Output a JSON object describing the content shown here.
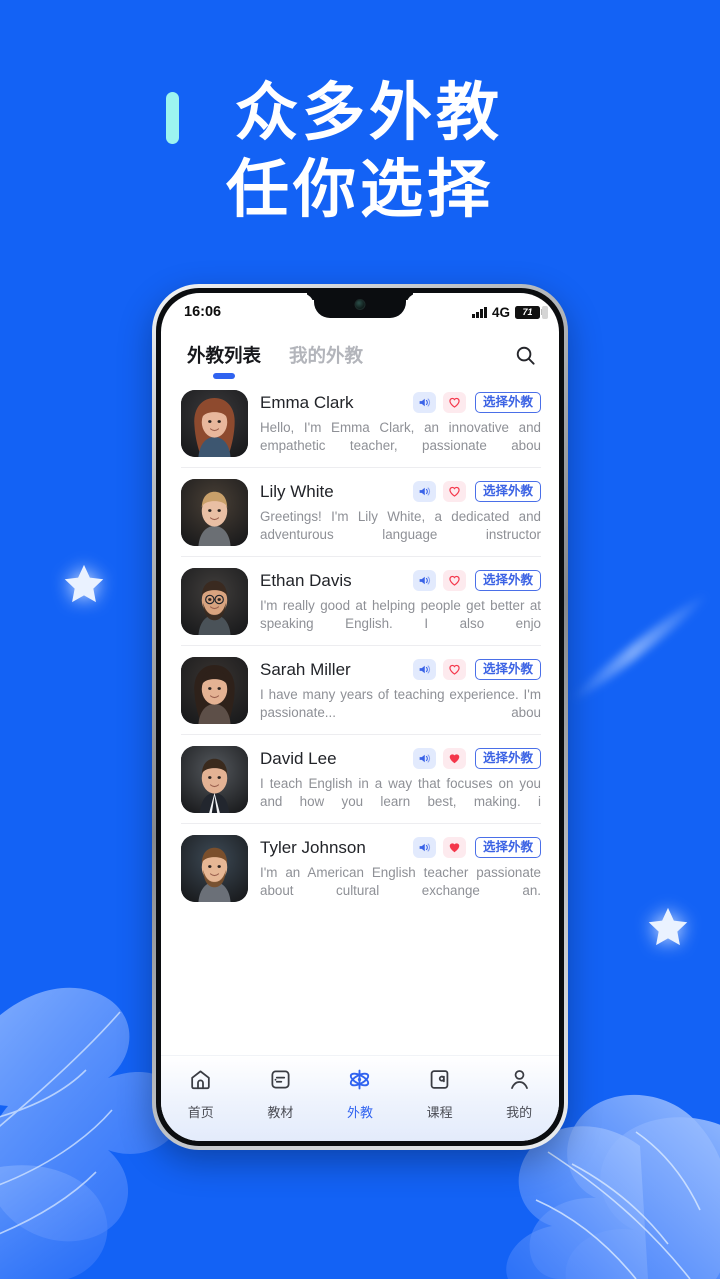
{
  "theme": {
    "background": "#1362F5",
    "accent_bar": "#9CF4F0",
    "brand_blue": "#3063F0",
    "heart_filled": "#F4374B",
    "heart_outline": "#F4374B"
  },
  "headline": {
    "line1": "众多外教",
    "line2": "任你选择"
  },
  "phone": {
    "status_bar": {
      "time": "16:06",
      "network": "4G",
      "battery_level": "71",
      "signal_icon": "signal-bars-icon"
    },
    "tabs": [
      {
        "label": "外教列表",
        "active": true
      },
      {
        "label": "我的外教",
        "active": false
      }
    ],
    "search_icon": "search-icon",
    "teachers": [
      {
        "name": "Emma Clark",
        "description": "Hello, I'm Emma Clark, an innovative and empathetic teacher, passionate abou",
        "favorited": false,
        "sound_icon": "speaker-icon",
        "fav_icon": "heart-icon",
        "choose_label": "选择外教"
      },
      {
        "name": "Lily White",
        "description": "Greetings! I'm Lily White, a dedicated and adventurous language instructor",
        "favorited": false,
        "sound_icon": "speaker-icon",
        "fav_icon": "heart-icon",
        "choose_label": "选择外教"
      },
      {
        "name": "Ethan Davis",
        "description": "I'm really good at helping people get better at speaking English. I also enjo",
        "favorited": false,
        "sound_icon": "speaker-icon",
        "fav_icon": "heart-icon",
        "choose_label": "选择外教"
      },
      {
        "name": "Sarah Miller",
        "description": "I have many years of teaching experience. I'm passionate... abou",
        "favorited": false,
        "sound_icon": "speaker-icon",
        "fav_icon": "heart-icon",
        "choose_label": "选择外教"
      },
      {
        "name": "David Lee",
        "description": "I teach English in a way that focuses on you and how you learn best, making. i",
        "favorited": true,
        "sound_icon": "speaker-icon",
        "fav_icon": "heart-filled-icon",
        "choose_label": "选择外教"
      },
      {
        "name": "Tyler Johnson",
        "description": "I'm an American English teacher passionate about cultural exchange an.",
        "favorited": true,
        "sound_icon": "speaker-icon",
        "fav_icon": "heart-filled-icon",
        "choose_label": "选择外教"
      }
    ],
    "bottom_nav": [
      {
        "label": "首页",
        "icon": "home-icon",
        "active": false
      },
      {
        "label": "教材",
        "icon": "book-icon",
        "active": false
      },
      {
        "label": "外教",
        "icon": "atom-icon",
        "active": true
      },
      {
        "label": "课程",
        "icon": "course-icon",
        "active": false
      },
      {
        "label": "我的",
        "icon": "person-icon",
        "active": false
      }
    ]
  }
}
